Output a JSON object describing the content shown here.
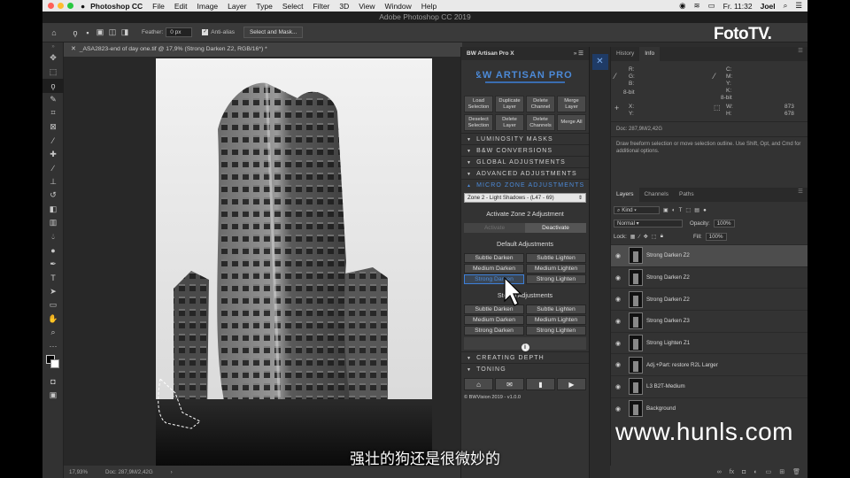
{
  "menubar": {
    "app": "Photoshop CC",
    "items": [
      "File",
      "Edit",
      "Image",
      "Layer",
      "Type",
      "Select",
      "Filter",
      "3D",
      "View",
      "Window",
      "Help"
    ],
    "clock": "Fr. 11:32",
    "user": "Joel"
  },
  "titlebar": "Adobe Photoshop CC 2019",
  "options": {
    "feather_label": "Feather:",
    "feather_value": "0 px",
    "antialias_label": "Anti-alias",
    "select_mask": "Select and Mask..."
  },
  "document": {
    "tab": "_ASA2823-end of day one.tif @ 17,9% (Strong Darken Z2, RGB/16*) *",
    "zoom": "17,93%",
    "doc_size": "Doc: 287,9M/2,42G"
  },
  "plugin": {
    "title": "BW Artisan Pro X",
    "buttons_row1": [
      "Load Selection",
      "Duplicate Layer",
      "Delete Channel",
      "Merge Layer"
    ],
    "buttons_row2": [
      "Deselect Selection",
      "Delete Layer",
      "Delete Channels",
      "Merge All"
    ],
    "sections_top": [
      "LUMINOSITY MASKS",
      "B&W CONVERSIONS",
      "GLOBAL ADJUSTMENTS",
      "ADVANCED ADJUSTMENTS"
    ],
    "micro_zone": "MICRO ZONE ADJUSTMENTS",
    "zone_select": "Zone 2 - Light Shadows - (L47 - 69)",
    "activate_label": "Activate Zone 2 Adjustment",
    "activate": "Activate",
    "deactivate": "Deactivate",
    "default_label": "Default Adjustments",
    "default_rows": [
      [
        "Subtle Darken",
        "Subtle Lighten"
      ],
      [
        "Medium Darken",
        "Medium Lighten"
      ],
      [
        "Strong Darken",
        "Strong Lighten"
      ]
    ],
    "stored_label": "Stored Adjustments",
    "stored_rows": [
      [
        "Subtle Darken",
        "Subtle Lighten"
      ],
      [
        "Medium Darken",
        "Medium Lighten"
      ],
      [
        "Strong Darken",
        "Strong Lighten"
      ]
    ],
    "sections_bottom": [
      "CREATING DEPTH",
      "TONING"
    ],
    "copyright": "© BWVision 2019 - v1.0.0"
  },
  "panels": {
    "info_tabs": [
      "History",
      "Info"
    ],
    "info": {
      "r": "R:",
      "g": "G:",
      "b": "B:",
      "bit_left": "8-bit",
      "c": "C:",
      "m": "M:",
      "y": "Y:",
      "k": "K:",
      "bit_right": "8-bit",
      "x": "X:",
      "y2": "Y:",
      "w": "W:",
      "h": "H:",
      "w_value": "873",
      "h_value": "678",
      "doc": "Doc: 287,9M/2,42G",
      "hint": "Draw freeform selection or move selection outline.  Use Shift, Opt, and Cmd for additional options."
    },
    "layer_tabs": [
      "Layers",
      "Channels",
      "Paths"
    ],
    "kind": "Kind",
    "blend": "Normal",
    "opacity_label": "Opacity:",
    "opacity": "100%",
    "lock_label": "Lock:",
    "fill_label": "Fill:",
    "fill": "100%",
    "layers": [
      "Strong Darken Z2",
      "Strong Darken Z2",
      "Strong Darken Z2",
      "Strong Darken Z3",
      "Strong Lighten Z1",
      "Adj.+Part: restore R2L Larger",
      "L3 B2T-Medium",
      "Background"
    ]
  },
  "overlay": {
    "brand": "FotoTV.",
    "watermark": "www.hunls.com",
    "subtitle": "强壮的狗还是很微妙的"
  },
  "colors": {
    "highlight": "#4c8ad8",
    "plugin_bg": "#333333"
  }
}
